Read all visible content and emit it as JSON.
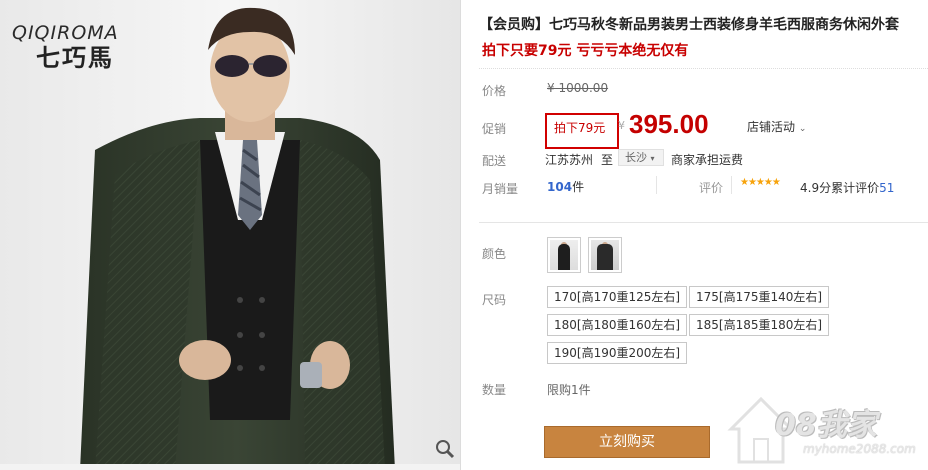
{
  "brand": {
    "logo_en": "QIQIROMA",
    "logo_cn": "七巧馬"
  },
  "product": {
    "title": "【会员购】七巧马秋冬新品男装男士西装修身羊毛西服商务休闲外套",
    "subtitle": "拍下只要79元 亏亏亏本绝无仅有"
  },
  "price_row": {
    "label": "价格",
    "original_price": "¥ 1000.00"
  },
  "promo_row": {
    "label": "促销",
    "tag": "拍下79元",
    "currency": "¥",
    "price": "395.00",
    "store_activity": "店铺活动"
  },
  "shipping_row": {
    "label": "配送",
    "from": "江苏苏州",
    "to_word": "至",
    "city": "长沙",
    "fee_text": "商家承担运费"
  },
  "sales_row": {
    "label": "月销量",
    "count": "104",
    "unit": "件",
    "rating_label": "评价",
    "stars": "★★★★★",
    "rating_value": "4.9分",
    "total_reviews_label": "累计评价",
    "total_reviews": "51"
  },
  "color_row": {
    "label": "颜色"
  },
  "size_row": {
    "label": "尺码",
    "options": [
      "170[高170重125左右]",
      "175[高175重140左右]",
      "180[高180重160左右]",
      "185[高185重180左右]",
      "190[高190重200左右]"
    ]
  },
  "qty_row": {
    "label": "数量",
    "limit": "限购1件"
  },
  "buy_button": "立刻购买",
  "watermark": {
    "text": "08我家",
    "url": "myhome2088.com"
  },
  "colors": {
    "accent_red": "#c80000",
    "price_red": "#c40000",
    "buy_button": "#c8843f",
    "link_blue": "#3366cc",
    "star_orange": "#f7a30c"
  }
}
